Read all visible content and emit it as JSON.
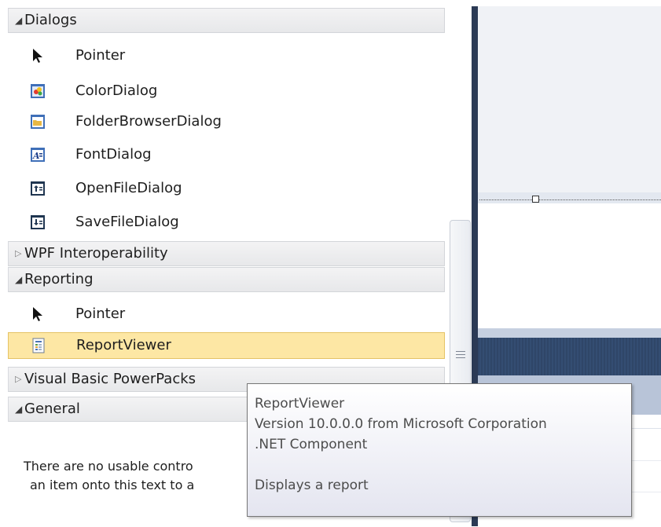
{
  "toolbox": {
    "categories": [
      {
        "name": "Dialogs",
        "expanded": true,
        "items": [
          {
            "label": "Pointer",
            "icon": "pointer-icon"
          },
          {
            "label": "ColorDialog",
            "icon": "color-dialog-icon"
          },
          {
            "label": "FolderBrowserDialog",
            "icon": "folder-browser-dialog-icon"
          },
          {
            "label": "FontDialog",
            "icon": "font-dialog-icon"
          },
          {
            "label": "OpenFileDialog",
            "icon": "open-file-dialog-icon"
          },
          {
            "label": "SaveFileDialog",
            "icon": "save-file-dialog-icon"
          }
        ]
      },
      {
        "name": "WPF Interoperability",
        "expanded": false,
        "items": []
      },
      {
        "name": "Reporting",
        "expanded": true,
        "items": [
          {
            "label": "Pointer",
            "icon": "pointer-icon"
          },
          {
            "label": "ReportViewer",
            "icon": "report-viewer-icon",
            "selected": true
          }
        ]
      },
      {
        "name": "Visual Basic PowerPacks",
        "expanded": false,
        "items": []
      },
      {
        "name": "General",
        "expanded": true,
        "items": []
      }
    ],
    "empty_message": {
      "line1": "There are no usable contro",
      "line2": "an item onto this text to a"
    }
  },
  "tooltip": {
    "title": "ReportViewer",
    "version": "Version 10.0.0.0 from Microsoft Corporation",
    "component_type": ".NET Component",
    "description": "Displays a report"
  },
  "colors": {
    "selected_item_bg": "#fde7a4",
    "category_header_bg": "#e7e8ea",
    "designer_frame": "#2b3a55"
  }
}
